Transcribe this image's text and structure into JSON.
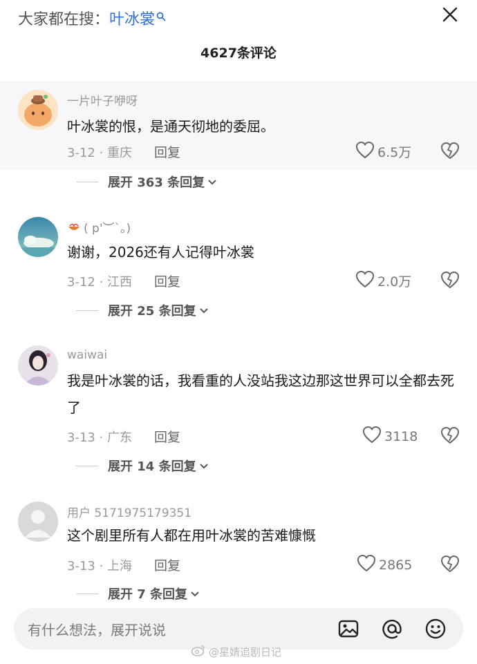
{
  "top": {
    "search_prefix": "大家都在搜：",
    "search_keyword": "叶冰裳"
  },
  "comment_count_title": "4627条评论",
  "comments": [
    {
      "username": "一片叶子咿呀",
      "text": "叶冰裳的恨，是通天彻地的委屈。",
      "date_location": "3-12 · 重庆",
      "reply_label": "回复",
      "likes": "6.5万",
      "expand_label": "展开 363 条回复"
    },
    {
      "username": "( p'︶`。)",
      "text": "谢谢，2026还有人记得叶冰裳",
      "date_location": "3-12 · 江西",
      "reply_label": "回复",
      "likes": "2.0万",
      "expand_label": "展开 25 条回复"
    },
    {
      "username": "waiwai",
      "text": "我是叶冰裳的话，我看重的人没站我这边那这世界可以全都去死了",
      "date_location": "3-13 · 广东",
      "reply_label": "回复",
      "likes": "3118",
      "expand_label": "展开 14 条回复"
    },
    {
      "username": "用户 5171975179351",
      "text": "这个剧里所有人都在用叶冰裳的苦难慷慨",
      "date_location": "3-13 · 上海",
      "reply_label": "回复",
      "likes": "2865",
      "expand_label": "展开 7 条回复"
    }
  ],
  "input": {
    "placeholder": "有什么想法，展开说说"
  },
  "watermark": "@星婧追剧日记",
  "colors": {
    "keyword_blue": "#2f6fd6",
    "muted_gray": "#999999",
    "first_comment_bg": "#f7f7f9",
    "input_bg": "#f2f2f4"
  }
}
